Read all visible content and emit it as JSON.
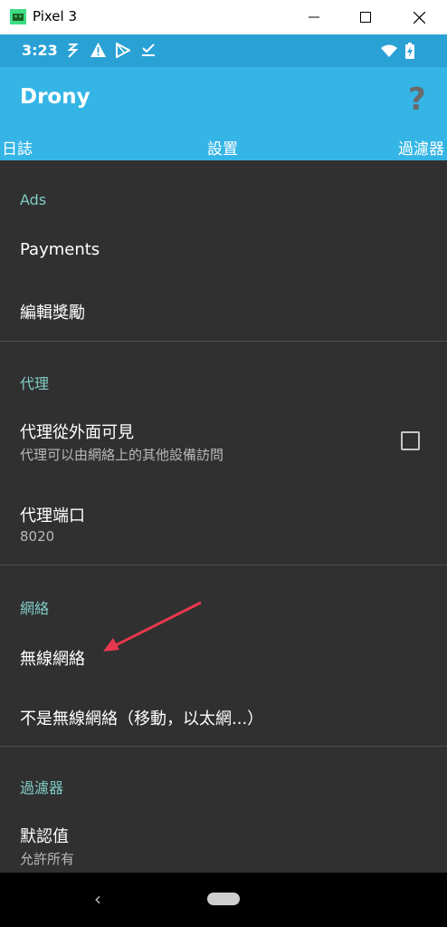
{
  "window": {
    "title": "Pixel 3"
  },
  "statusbar": {
    "time": "3:23"
  },
  "appbar": {
    "title": "Drony",
    "help": "?"
  },
  "tabs": [
    "日誌",
    "設置",
    "過濾器"
  ],
  "sections": {
    "ads": {
      "category": "Ads",
      "items": [
        {
          "title": "Payments"
        },
        {
          "title": "編輯獎勵"
        }
      ]
    },
    "proxy": {
      "category": "代理",
      "visible_title": "代理從外面可見",
      "visible_summary": "代理可以由網絡上的其他設備訪問",
      "port_title": "代理端口",
      "port_value": "8020"
    },
    "network": {
      "category": "網絡",
      "wifi": "無線網絡",
      "not_wifi": "不是無線網絡（移動，以太網...）"
    },
    "filter": {
      "category": "過濾器",
      "default_title": "默認值",
      "default_summary": "允許所有"
    }
  },
  "colors": {
    "statusbar": "#2aa1d5",
    "appbar": "#34b5e6",
    "accent": "#80cbc4",
    "background": "#303030",
    "annotation_arrow": "#e8384f"
  }
}
